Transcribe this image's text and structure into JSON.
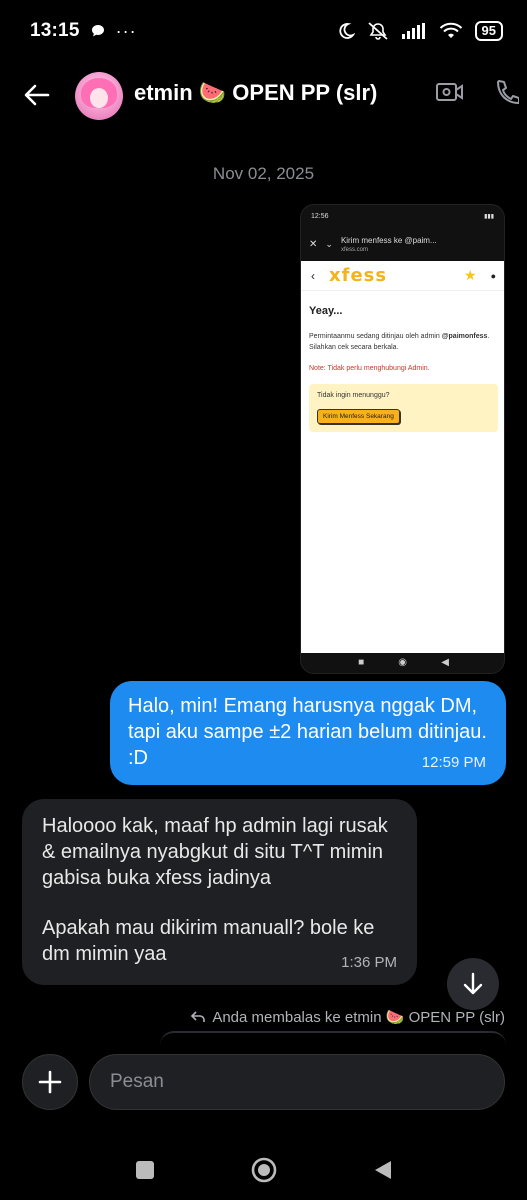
{
  "status_bar": {
    "time": "13:15",
    "battery": "95"
  },
  "header": {
    "title": "etmin 🍉 OPEN PP (slr)"
  },
  "date_separator": "Nov 02, 2025",
  "shared_screenshot": {
    "time": "12:56",
    "url_title": "Kirim menfess ke @paim...",
    "url_domain": "xfess.com",
    "logo": "xfess",
    "heading": "Yeay...",
    "paragraph_prefix": "Permintaanmu sedang ditinjau oleh admin",
    "paragraph_handle": "@paimonfess",
    "paragraph_suffix": ". Silahkan cek secara berkala.",
    "note": "Note: Tidak perlu menghubungi Admin.",
    "question": "Tidak ingin menunggu?",
    "button": "Kirim Menfess Sekarang"
  },
  "messages": [
    {
      "direction": "out",
      "text": "Halo, min! Emang harusnya nggak DM, tapi aku sampe ±2 harian belum ditinjau. :D",
      "time": "12:59 PM"
    },
    {
      "direction": "in",
      "text": "Haloooo kak, maaf hp admin lagi rusak & emailnya nyabgkut di situ T^T mimin gabisa buka xfess jadinya",
      "text2": "Apakah mau dikirim manuall? bole ke dm mimin yaa",
      "time": "1:36 PM"
    }
  ],
  "reply_info": "Anda membalas ke etmin 🍉 OPEN PP (slr)",
  "composer": {
    "placeholder": "Pesan"
  },
  "colors": {
    "outgoing_bubble": "#1d8bf0",
    "incoming_bubble": "#1f2024",
    "background": "#000000"
  }
}
